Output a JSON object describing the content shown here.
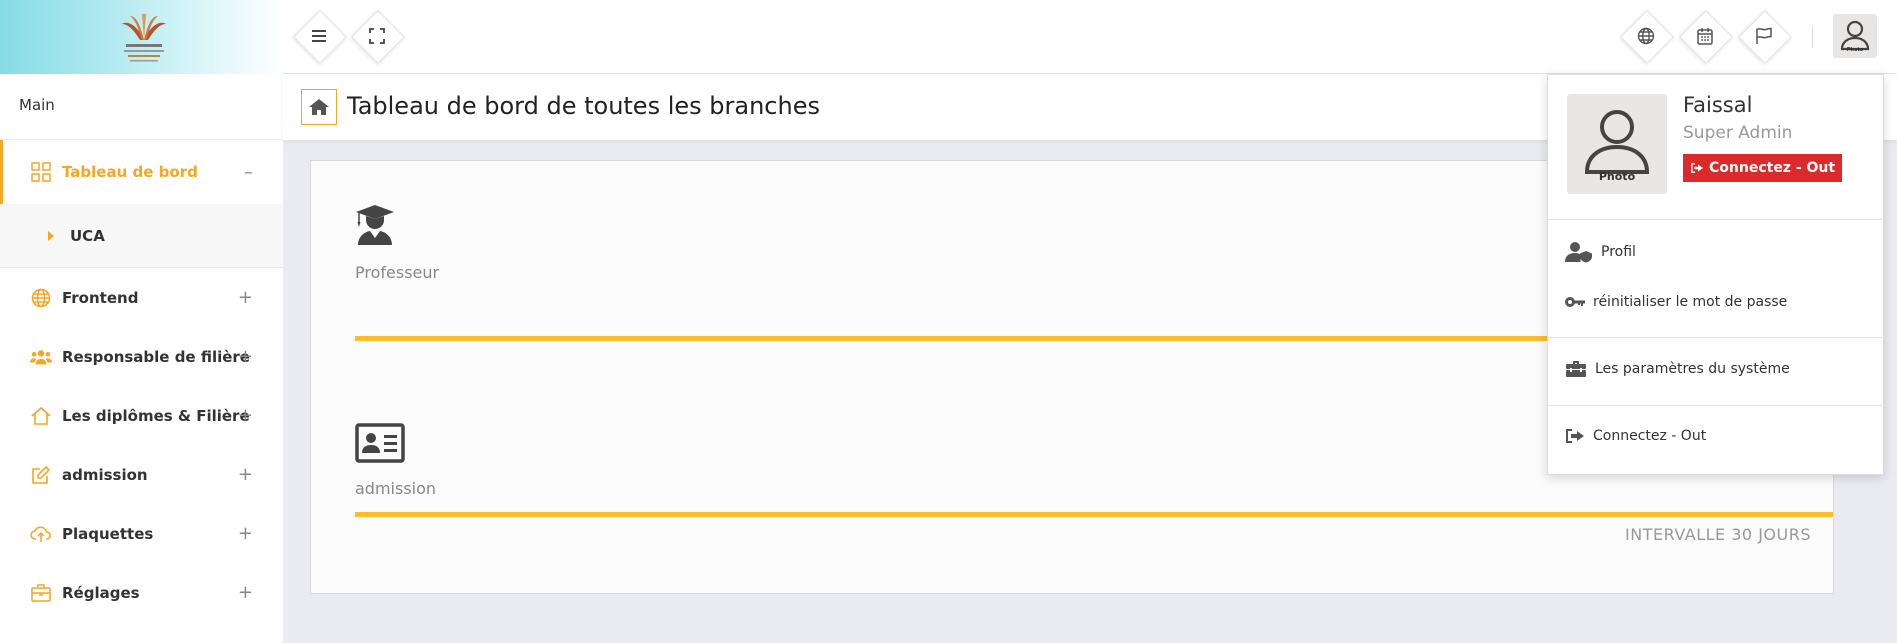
{
  "topbar": {
    "logo_icon": "university-logo",
    "menu_icon": "hamburger-icon",
    "fullscreen_icon": "fullscreen-icon",
    "right_icons": [
      "globe-icon",
      "calendar-icon",
      "flag-icon"
    ],
    "avatar_label": "Photo"
  },
  "sidebar": {
    "section_label": "Main",
    "items": [
      {
        "label": "Tableau de bord",
        "icon": "grid-icon",
        "toggle": "–",
        "active": true
      },
      {
        "label": "Frontend",
        "icon": "globe-icon",
        "toggle": "+"
      },
      {
        "label": "Responsable de filière",
        "icon": "users-icon",
        "toggle": "+"
      },
      {
        "label": "Les diplômes & Filière",
        "icon": "home-icon",
        "toggle": "+"
      },
      {
        "label": "admission",
        "icon": "edit-icon",
        "toggle": "+"
      },
      {
        "label": "Plaquettes",
        "icon": "cloud-upload-icon",
        "toggle": "+"
      },
      {
        "label": "Réglages",
        "icon": "briefcase-icon",
        "toggle": "+"
      }
    ],
    "sub_items": [
      {
        "label": "UCA"
      }
    ]
  },
  "header": {
    "title": "Tableau de bord de toutes les branches",
    "home_icon": "home-icon"
  },
  "main": {
    "stats": [
      {
        "label": "Professeur",
        "icon": "graduate-icon"
      },
      {
        "label": "admission",
        "icon": "id-card-icon"
      }
    ],
    "interval_text": "INTERVALLE 30 JOURS"
  },
  "profile_menu": {
    "name": "Faissal",
    "role": "Super Admin",
    "photo_label": "Photo",
    "logout_button": "Connectez - Out",
    "items": [
      {
        "label": "Profil",
        "icon": "user-shield-icon"
      },
      {
        "label": "réinitialiser le mot de passe",
        "icon": "key-icon"
      },
      {
        "label": "Les paramètres du système",
        "icon": "toolbox-icon"
      },
      {
        "label": "Connectez - Out",
        "icon": "sign-out-icon"
      }
    ]
  },
  "colors": {
    "accent": "#f5a623",
    "bar": "#fbbd2f",
    "danger": "#dc2a2a",
    "logo_gradient": "#86dbe6"
  }
}
